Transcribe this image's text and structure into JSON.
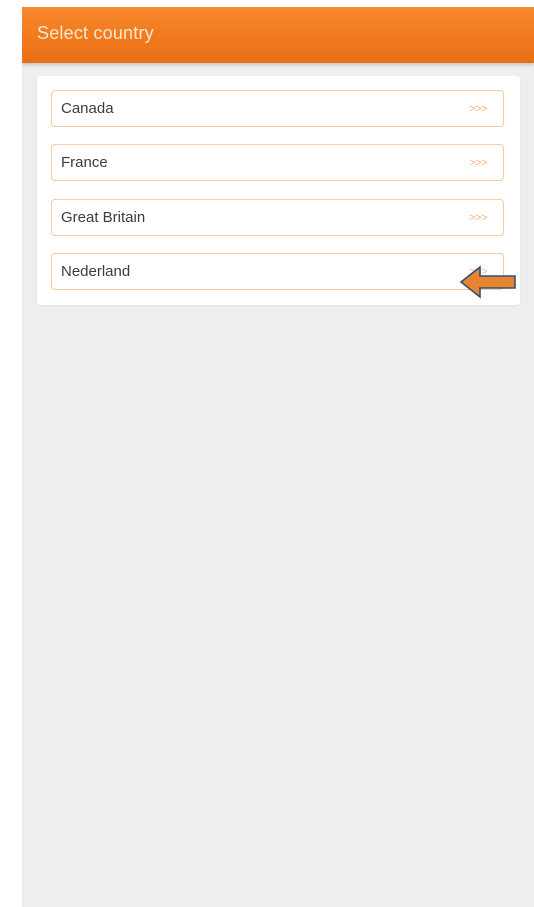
{
  "header": {
    "title": "Select country"
  },
  "countries": [
    {
      "label": "Canada",
      "chevron": ">>>"
    },
    {
      "label": "France",
      "chevron": ">>>"
    },
    {
      "label": "Great Britain",
      "chevron": ">>>"
    },
    {
      "label": "Nederland",
      "chevron": ">>>"
    }
  ],
  "colors": {
    "accent": "#f0761a",
    "item_border": "#f7c9a4",
    "chevron": "#f6b387",
    "background": "#eeeeee",
    "annotation_arrow": "#e8832e",
    "annotation_outline": "#2f4f7f"
  }
}
